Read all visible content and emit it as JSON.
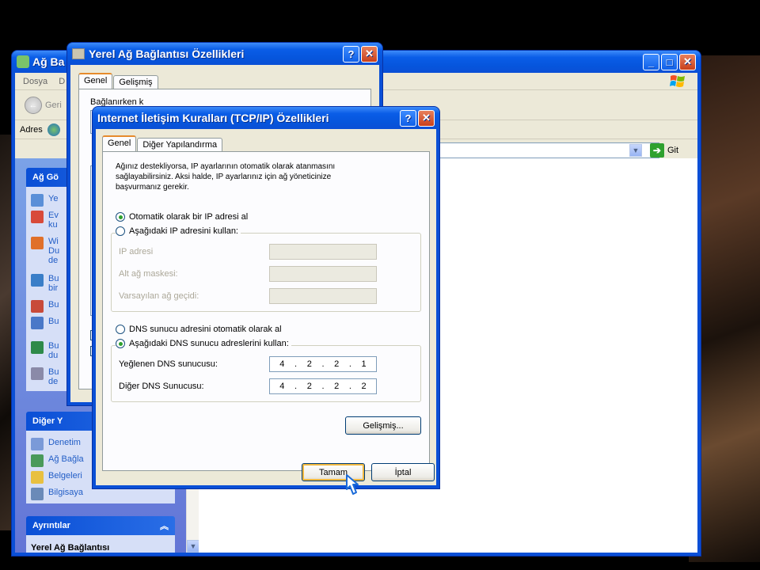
{
  "explorer": {
    "title": "Ağ Ba",
    "menu": [
      "Dosya",
      "D"
    ],
    "back_label": "Geri",
    "address_label": "Adres",
    "go_label": "Git",
    "task_panel_title": "Ağ Gö",
    "tasks": [
      {
        "label": "Ye",
        "icon": "network-icon"
      },
      {
        "label": "Ev ku",
        "icon": "wizard-icon"
      },
      {
        "label": "Wi Du de",
        "icon": "wireless-icon"
      },
      {
        "label": "Bu bir",
        "icon": "disable-icon"
      },
      {
        "label": "Bu",
        "icon": "repair-icon"
      },
      {
        "label": "Bu",
        "icon": "rename-icon"
      },
      {
        "label": "Bu du",
        "icon": "status-icon"
      },
      {
        "label": "Bu de",
        "icon": "settings-icon"
      }
    ],
    "other_panel_title": "Diğer Y",
    "other_places": [
      {
        "label": "Denetim",
        "icon": "control-panel-icon"
      },
      {
        "label": "Ağ Bağla",
        "icon": "network-places-icon"
      },
      {
        "label": "Belgeleri",
        "icon": "documents-icon"
      },
      {
        "label": "Bilgisaya",
        "icon": "computer-icon"
      }
    ],
    "details_panel_title": "Ayrıntılar",
    "details_text": "Yerel Ağ Bağlantısı"
  },
  "props": {
    "title": "Yerel Ağ Bağlantısı Özellikleri",
    "tabs": [
      "Genel",
      "Gelişmiş"
    ],
    "partial_label": "Bağlanırken k"
  },
  "tcpip": {
    "title": "Internet İletişim Kuralları (TCP/IP) Özellikleri",
    "tabs": [
      "Genel",
      "Diğer Yapılandırma"
    ],
    "description": "Ağınız destekliyorsa, IP ayarlarının otomatik olarak atanmasını sağlayabilirsiniz. Aksi halde, IP ayarlarınız için ağ yöneticinize başvurmanız gerekir.",
    "ip_auto_label": "Otomatik olarak bir IP adresi al",
    "ip_manual_label": "Aşağıdaki IP adresini kullan:",
    "ip_auto_selected": true,
    "ip_fields": [
      {
        "label": "IP adresi",
        "value": ""
      },
      {
        "label": "Alt ağ maskesi:",
        "value": ""
      },
      {
        "label": "Varsayılan ağ geçidi:",
        "value": ""
      }
    ],
    "dns_auto_label": "DNS sunucu adresini otomatik olarak al",
    "dns_manual_label": "Aşağıdaki DNS sunucu adreslerini kullan:",
    "dns_manual_selected": true,
    "dns_fields": [
      {
        "label": "Yeğlenen DNS sunucusu:",
        "octets": [
          "4",
          "2",
          "2",
          "1"
        ]
      },
      {
        "label": "Diğer DNS Sunucusu:",
        "octets": [
          "4",
          "2",
          "2",
          "2"
        ]
      }
    ],
    "advanced_label": "Gelişmiş...",
    "ok_label": "Tamam",
    "cancel_label": "İptal"
  },
  "colors": {
    "title_blue": "#0a4fd6",
    "dialog_bg": "#ece9d8",
    "task_pane_blue": "#6375d6"
  }
}
